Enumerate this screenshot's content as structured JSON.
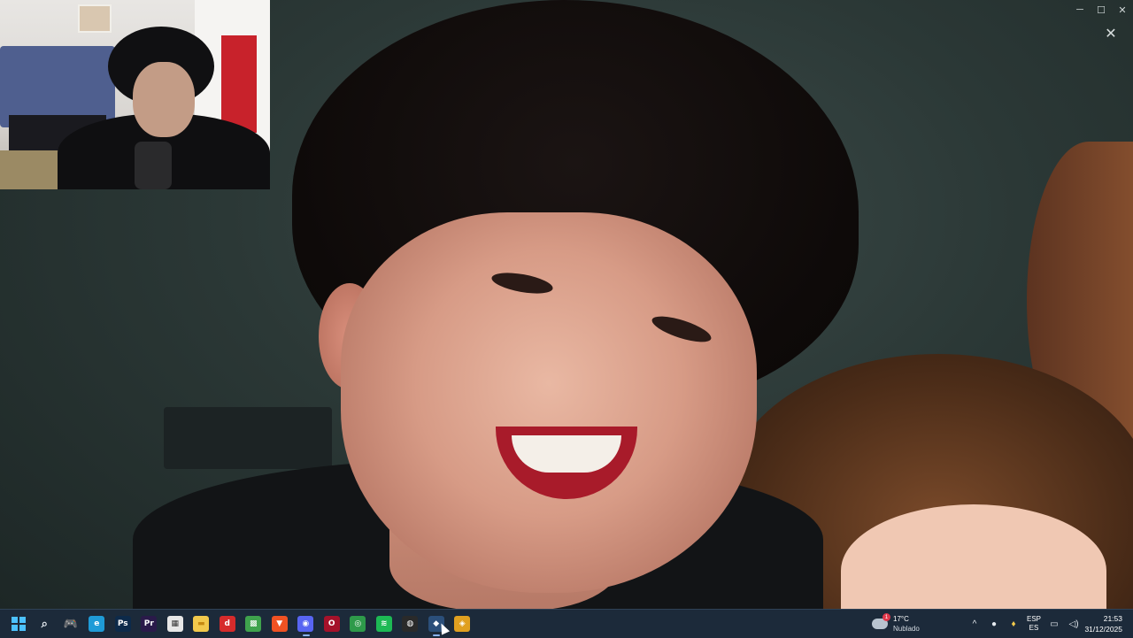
{
  "viewer": {
    "close_icon": "✕"
  },
  "window_controls": {
    "minimize": "─",
    "maximize": "☐",
    "close": "✕"
  },
  "taskbar": {
    "apps": [
      {
        "name": "start-button",
        "glyph": "",
        "color": "#4cc2ff"
      },
      {
        "name": "search-icon",
        "glyph": "⌕",
        "color": "transparent"
      },
      {
        "name": "game-controller-icon",
        "glyph": "🎮",
        "color": "transparent"
      },
      {
        "name": "edge-icon",
        "glyph": "e",
        "color": "#1f9bd7"
      },
      {
        "name": "photoshop-icon",
        "glyph": "Ps",
        "color": "#0d2a4a"
      },
      {
        "name": "premiere-icon",
        "glyph": "Pr",
        "color": "#2a1a4a"
      },
      {
        "name": "store-icon",
        "glyph": "▦",
        "color": "#e7e7e7"
      },
      {
        "name": "file-explorer-icon",
        "glyph": "▬",
        "color": "#f2c94c"
      },
      {
        "name": "red-app-icon",
        "glyph": "d",
        "color": "#d62b2b"
      },
      {
        "name": "minecraft-icon",
        "glyph": "▩",
        "color": "#3fa34d"
      },
      {
        "name": "brave-icon",
        "glyph": "▼",
        "color": "#f05223"
      },
      {
        "name": "discord-icon",
        "glyph": "◉",
        "color": "#5865f2"
      },
      {
        "name": "opera-icon",
        "glyph": "O",
        "color": "#a5122a"
      },
      {
        "name": "chrome-icon",
        "glyph": "◎",
        "color": "#2e9a4a"
      },
      {
        "name": "spotify-icon",
        "glyph": "≋",
        "color": "#1db954"
      },
      {
        "name": "obs-icon",
        "glyph": "◍",
        "color": "#2a2a2a"
      },
      {
        "name": "steam-icon",
        "glyph": "◆",
        "color": "#2b4f7a"
      },
      {
        "name": "layers-app-icon",
        "glyph": "◈",
        "color": "#e0a020"
      }
    ],
    "weather": {
      "temp": "17°C",
      "condition": "Nublado",
      "badge": "1"
    },
    "tray": {
      "chevron": "^",
      "lang_top": "ESP",
      "lang_bottom": "ES"
    },
    "clock": {
      "time": "21:53",
      "date": "31/12/2025"
    }
  }
}
